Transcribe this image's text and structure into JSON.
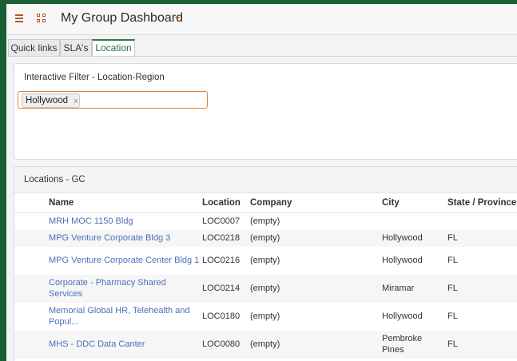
{
  "header": {
    "menu_icon": "hamburger-menu-icon",
    "apps_icon": "grid-icon",
    "title": "My Group Dashboard",
    "dropdown_icon": "caret-down-icon",
    "accent_color": "#b35a1f"
  },
  "tabs": [
    {
      "label": "Quick links",
      "active": false
    },
    {
      "label": "SLA's",
      "active": false
    },
    {
      "label": "Location",
      "active": true
    }
  ],
  "filter_panel": {
    "title": "Interactive Filter - Location-Region",
    "chip_label": "Hollywood",
    "chip_remove_glyph": "x"
  },
  "locations_panel": {
    "title": "Locations - GC",
    "columns": [
      "Name",
      "Location",
      "Company",
      "City",
      "State / Province"
    ],
    "rows": [
      {
        "name": "MRH MOC 1150 Bldg",
        "location": "LOC0007",
        "company": "(empty)",
        "city": "",
        "state": ""
      },
      {
        "name": "MPG Venture Corporate Bldg 3",
        "location": "LOC0218",
        "company": "(empty)",
        "city": "Hollywood",
        "state": "FL"
      },
      {
        "name": "MPG Venture Corporate Center Bldg 1",
        "location": "LOC0216",
        "company": "(empty)",
        "city": "Hollywood",
        "state": "FL"
      },
      {
        "name": "Corporate - Pharmacy Shared Services",
        "location": "LOC0214",
        "company": "(empty)",
        "city": "Miramar",
        "state": "FL"
      },
      {
        "name": "Memorial Global HR, Telehealth and Popul...",
        "location": "LOC0180",
        "company": "(empty)",
        "city": "Hollywood",
        "state": "FL"
      },
      {
        "name": "MHS - DDC Data Canter",
        "location": "LOC0080",
        "company": "(empty)",
        "city": "Pembroke Pines",
        "state": "FL"
      }
    ],
    "link_color": "#4a72b8"
  }
}
